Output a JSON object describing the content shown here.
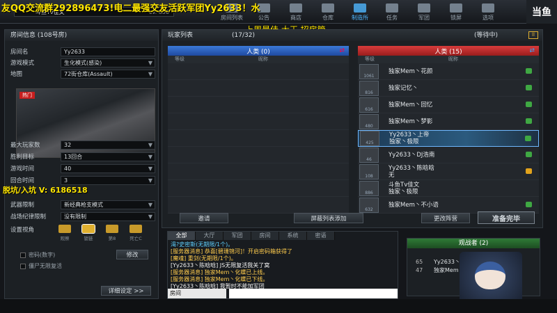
{
  "overlay": {
    "ad_text": "友QQ交流群292896473!电二最强交友活跃军团Yy2633！水",
    "banner": "上周最佳    大王    招房管",
    "wechat": "脱坑/入坑 V: 6186518"
  },
  "profile": {
    "name": "斗鱼Tv佳文",
    "level": "Lv. 886"
  },
  "logo": "当鱼",
  "topnav": [
    {
      "label": "房间列表",
      "icon": "list-icon"
    },
    {
      "label": "公告",
      "icon": "megaphone-icon"
    },
    {
      "label": "商店",
      "icon": "shop-icon"
    },
    {
      "label": "仓库",
      "icon": "warehouse-icon"
    },
    {
      "label": "制造所",
      "icon": "factory-icon"
    },
    {
      "label": "任务",
      "icon": "task-icon"
    },
    {
      "label": "军团",
      "icon": "clan-icon"
    },
    {
      "label": "锁屏",
      "icon": "lock-icon"
    },
    {
      "label": "选项",
      "icon": "options-icon"
    }
  ],
  "room": {
    "title": "房间信息",
    "room_no": "(108号房)",
    "name_label": "房间名",
    "name_value": "Yy2633",
    "mode_label": "游戏模式",
    "mode_value": "生化模式(感染)",
    "map_label": "地图",
    "map_value": "72街仓库(Assault)",
    "hot_badge": "热门",
    "max_label": "最大玩家数",
    "max_value": "32",
    "win_label": "胜利目标",
    "win_value": "13回合",
    "time_label": "游戏时间",
    "time_value": "40",
    "round_label": "回合时间",
    "round_value": "3",
    "weapon_label": "武器限制",
    "weapon_value": "新经典枪支模式",
    "rule_label": "战场纪律限制",
    "rule_value": "没有限制",
    "view_label": "设置视角",
    "view_options": [
      "观察",
      "锁链",
      "第8",
      "死亡C"
    ],
    "edit_btn": "修改",
    "pwd_label": "密码(数字)",
    "hide_label": "僵尸无限复活",
    "detail_btn": "详细设定 >>"
  },
  "players": {
    "title": "玩家列表",
    "count": "(17/32)",
    "status": "(等待中)",
    "col_level": "等级",
    "col_nick": "昵称",
    "blue_team": "人类 (0)",
    "red_team": "人类 (15)",
    "red_slots": [
      {
        "n1": "独家Mem丶花颜",
        "n2": "",
        "lv": "1061",
        "st": "green"
      },
      {
        "n1": "独家记忆丶",
        "n2": "",
        "lv": "816",
        "st": "green"
      },
      {
        "n1": "独家Mem丶回忆",
        "n2": "",
        "lv": "616",
        "st": "green"
      },
      {
        "n1": "独家Mem丶梦影",
        "n2": "",
        "lv": "480",
        "st": "green"
      },
      {
        "n1": "Yy2633丶上帝",
        "n2": "独家丶极限",
        "lv": "425",
        "st": "green",
        "hl": true
      },
      {
        "n1": "Yy2633丶DJ浩南",
        "n2": "",
        "lv": "46",
        "st": "green"
      },
      {
        "n1": "Yy2633丶陈晗晗",
        "n2": "无",
        "lv": "108",
        "st": "gold"
      },
      {
        "n1": "斗鱼Tv佳文",
        "n2": "独家丶极限",
        "lv": "886",
        "st": "none"
      },
      {
        "n1": "独家Mem丶不小语",
        "n2": "",
        "lv": "632",
        "st": "green"
      }
    ],
    "btn_invite": "邀请",
    "btn_block": "屏蔽列表添加",
    "btn_team": "更改阵营",
    "btn_ready": "准备完毕"
  },
  "chat": {
    "tabs": [
      "全部",
      "大厅",
      "军团",
      "房间",
      "系统",
      "密语"
    ],
    "lines": [
      {
        "text": "渴?史密斯(无期限/1个)。",
        "color": "#5fd0ff"
      },
      {
        "text": "[服务器消息] 恭喜[碧珊锦河]！开启密码箱获得了",
        "color": "#ffcc4d"
      },
      {
        "text": "[魔魂] 重剑(无期限/1个)。",
        "color": "#ffcc4d"
      },
      {
        "text": "[Yy2633丶陈晗晗] JS无限复活我关了窝",
        "color": "#f2f2f2"
      },
      {
        "text": "[服务器消息] 独家Mem丶化蝶已上线。",
        "color": "#ffcc4d"
      },
      {
        "text": "[服务器消息] 独家Mem丶化蝶已下线。",
        "color": "#ffcc4d"
      },
      {
        "text": "[Yy2633丶陈晗晗] 我暂时不能加军团",
        "color": "#f2f2f2"
      }
    ],
    "channel": "房间"
  },
  "spectators": {
    "title": "观战者 (2)",
    "rows": [
      {
        "num": "65",
        "name": "Yy2633丶"
      },
      {
        "num": "47",
        "name": "独家Mem"
      }
    ]
  },
  "colors": {
    "blue": "#2f6fd1",
    "red": "#c42a2a",
    "accent": "#4fb6ff",
    "green": "#3fa843"
  }
}
